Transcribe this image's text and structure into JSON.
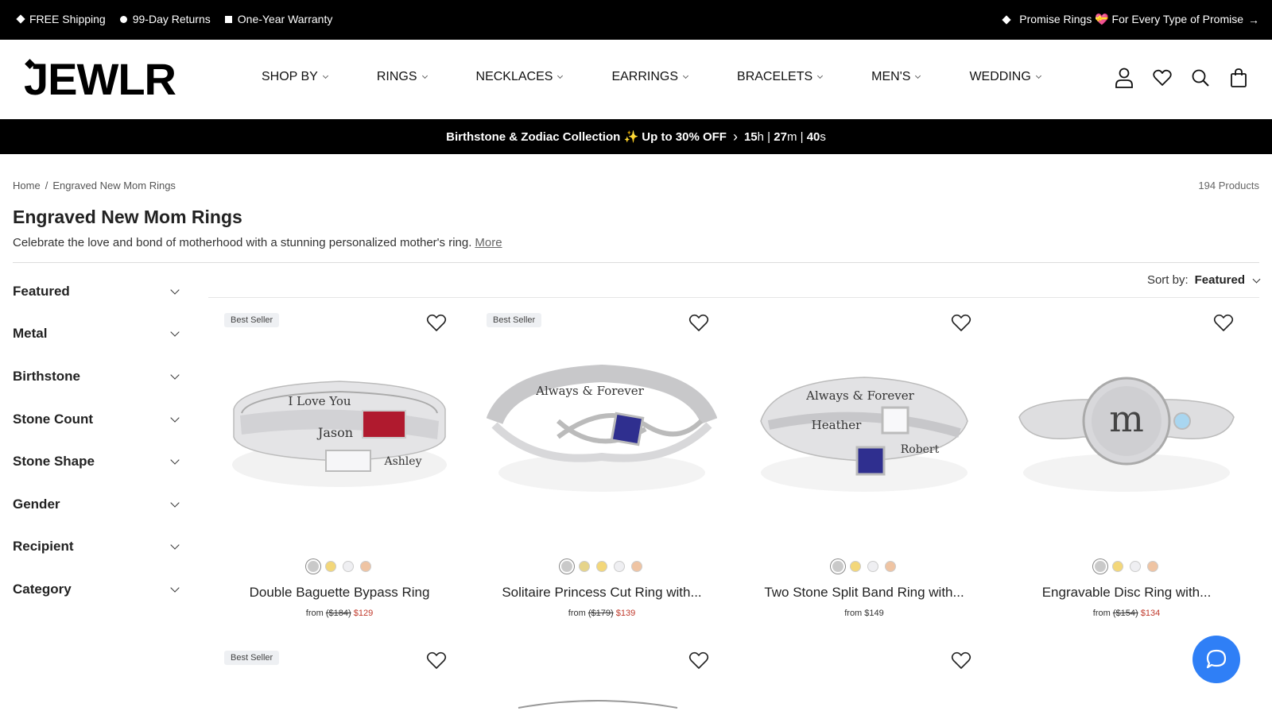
{
  "topbar": {
    "left": [
      {
        "icon": "diamond-icon",
        "label": "FREE Shipping"
      },
      {
        "icon": "dot-icon",
        "label": "99-Day Returns"
      },
      {
        "icon": "square-icon",
        "label": "One-Year Warranty"
      }
    ],
    "right_label": "Promise Rings 💝 For Every Type of Promise",
    "right_arrow": "→"
  },
  "header": {
    "logo": "JEWLR",
    "nav": [
      {
        "label": "SHOP BY"
      },
      {
        "label": "RINGS"
      },
      {
        "label": "NECKLACES"
      },
      {
        "label": "EARRINGS"
      },
      {
        "label": "BRACELETS"
      },
      {
        "label": "MEN'S"
      },
      {
        "label": "WEDDING"
      }
    ],
    "icons": [
      "account-icon",
      "wishlist-heart-icon",
      "search-icon",
      "cart-bag-icon"
    ]
  },
  "promo": {
    "text": "Birthstone & Zodiac Collection ✨ Up to 30% OFF",
    "arrow": "›",
    "hours": "15",
    "h": "h",
    "minutes": "27",
    "m": "m",
    "seconds": "40",
    "s": "s",
    "sep": "|"
  },
  "breadcrumb": {
    "home": "Home",
    "sep": "/",
    "current": "Engraved New Mom Rings"
  },
  "product_count": "194 Products",
  "page": {
    "title": "Engraved New Mom Rings",
    "description": "Celebrate the love and bond of motherhood with a stunning personalized mother's ring.",
    "more": "More"
  },
  "filters": [
    "Featured",
    "Metal",
    "Birthstone",
    "Stone Count",
    "Stone Shape",
    "Gender",
    "Recipient",
    "Category"
  ],
  "sort": {
    "label": "Sort by:",
    "value": "Featured"
  },
  "colors": {
    "silver": "#c9c9c9",
    "gold": "#f3d77a",
    "white": "#efeff2",
    "rose": "#efc4a3",
    "accent_blue": "#2f7ff6",
    "sale_red": "#c0392b"
  },
  "products": [
    {
      "badge": "Best Seller",
      "name": "Double Baguette Bypass Ring",
      "from": "from",
      "old": "($184)",
      "price": "$129",
      "engraving1": "I Love You",
      "engraving2": "Jason",
      "engraving3": "Ashley"
    },
    {
      "badge": "Best Seller",
      "name": "Solitaire Princess Cut Ring with...",
      "from": "from",
      "old": "($179)",
      "price": "$139",
      "engraving1": "Always & Forever"
    },
    {
      "badge": "",
      "name": "Two Stone Split Band Ring with...",
      "from": "from",
      "old": "",
      "price": "$149",
      "engraving1": "Always & Forever",
      "engraving2": "Heather",
      "engraving3": "Robert"
    },
    {
      "badge": "",
      "name": "Engravable Disc Ring with...",
      "from": "from",
      "old": "($154)",
      "price": "$134",
      "engraving1": "m"
    }
  ],
  "row2": [
    {
      "badge": "Best Seller"
    },
    {
      "badge": ""
    },
    {
      "badge": ""
    },
    {
      "badge": ""
    }
  ]
}
